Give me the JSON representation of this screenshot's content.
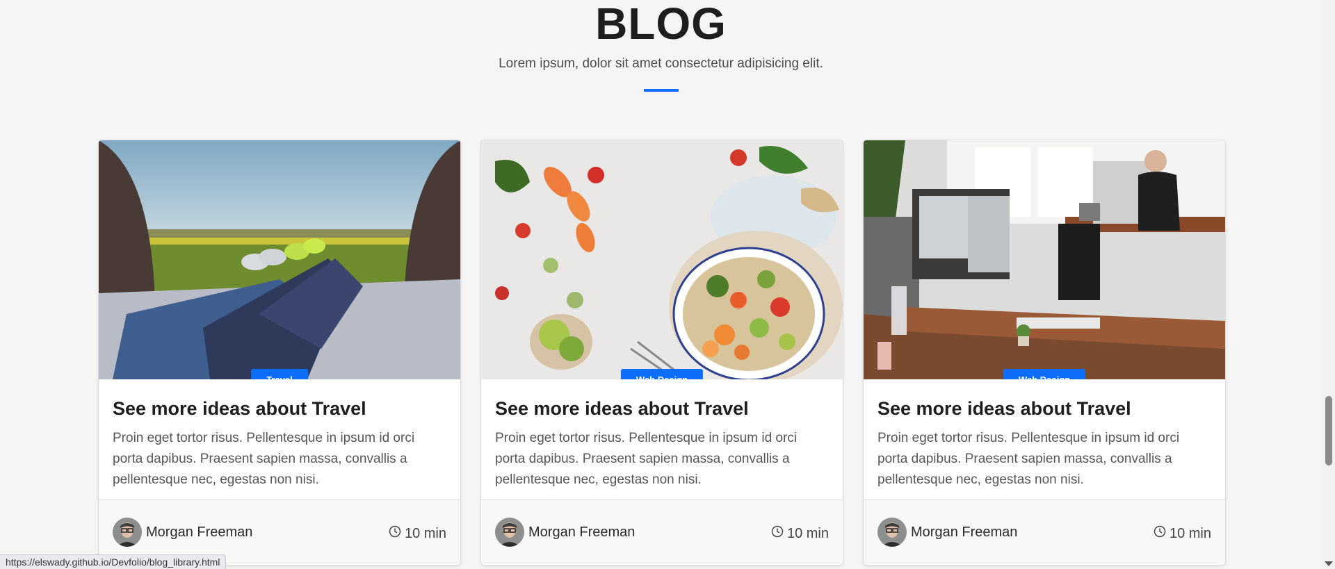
{
  "section": {
    "title": "BLOG",
    "subtitle": "Lorem ipsum, dolor sit amet consectetur adipisicing elit."
  },
  "colors": {
    "accent": "#0d6efd",
    "background": "#f5f5f5"
  },
  "cards": [
    {
      "category": "Travel",
      "title": "See more ideas about Travel",
      "text": "Proin eget tortor risus. Pellentesque in ipsum id orci porta dapibus. Praesent sapien massa, convallis a pellentesque nec, egestas non nisi.",
      "author": "Morgan Freeman",
      "read_time": "10 min",
      "image": "travel-photo"
    },
    {
      "category": "Web Design",
      "title": "See more ideas about Travel",
      "text": "Proin eget tortor risus. Pellentesque in ipsum id orci porta dapibus. Praesent sapien massa, convallis a pellentesque nec, egestas non nisi.",
      "author": "Morgan Freeman",
      "read_time": "10 min",
      "image": "food-photo"
    },
    {
      "category": "Web Design",
      "title": "See more ideas about Travel",
      "text": "Proin eget tortor risus. Pellentesque in ipsum id orci porta dapibus. Praesent sapien massa, convallis a pellentesque nec, egestas non nisi.",
      "author": "Morgan Freeman",
      "read_time": "10 min",
      "image": "office-photo"
    }
  ],
  "status_bar": {
    "url": "https://elswady.github.io/Devfolio/blog_library.html"
  }
}
